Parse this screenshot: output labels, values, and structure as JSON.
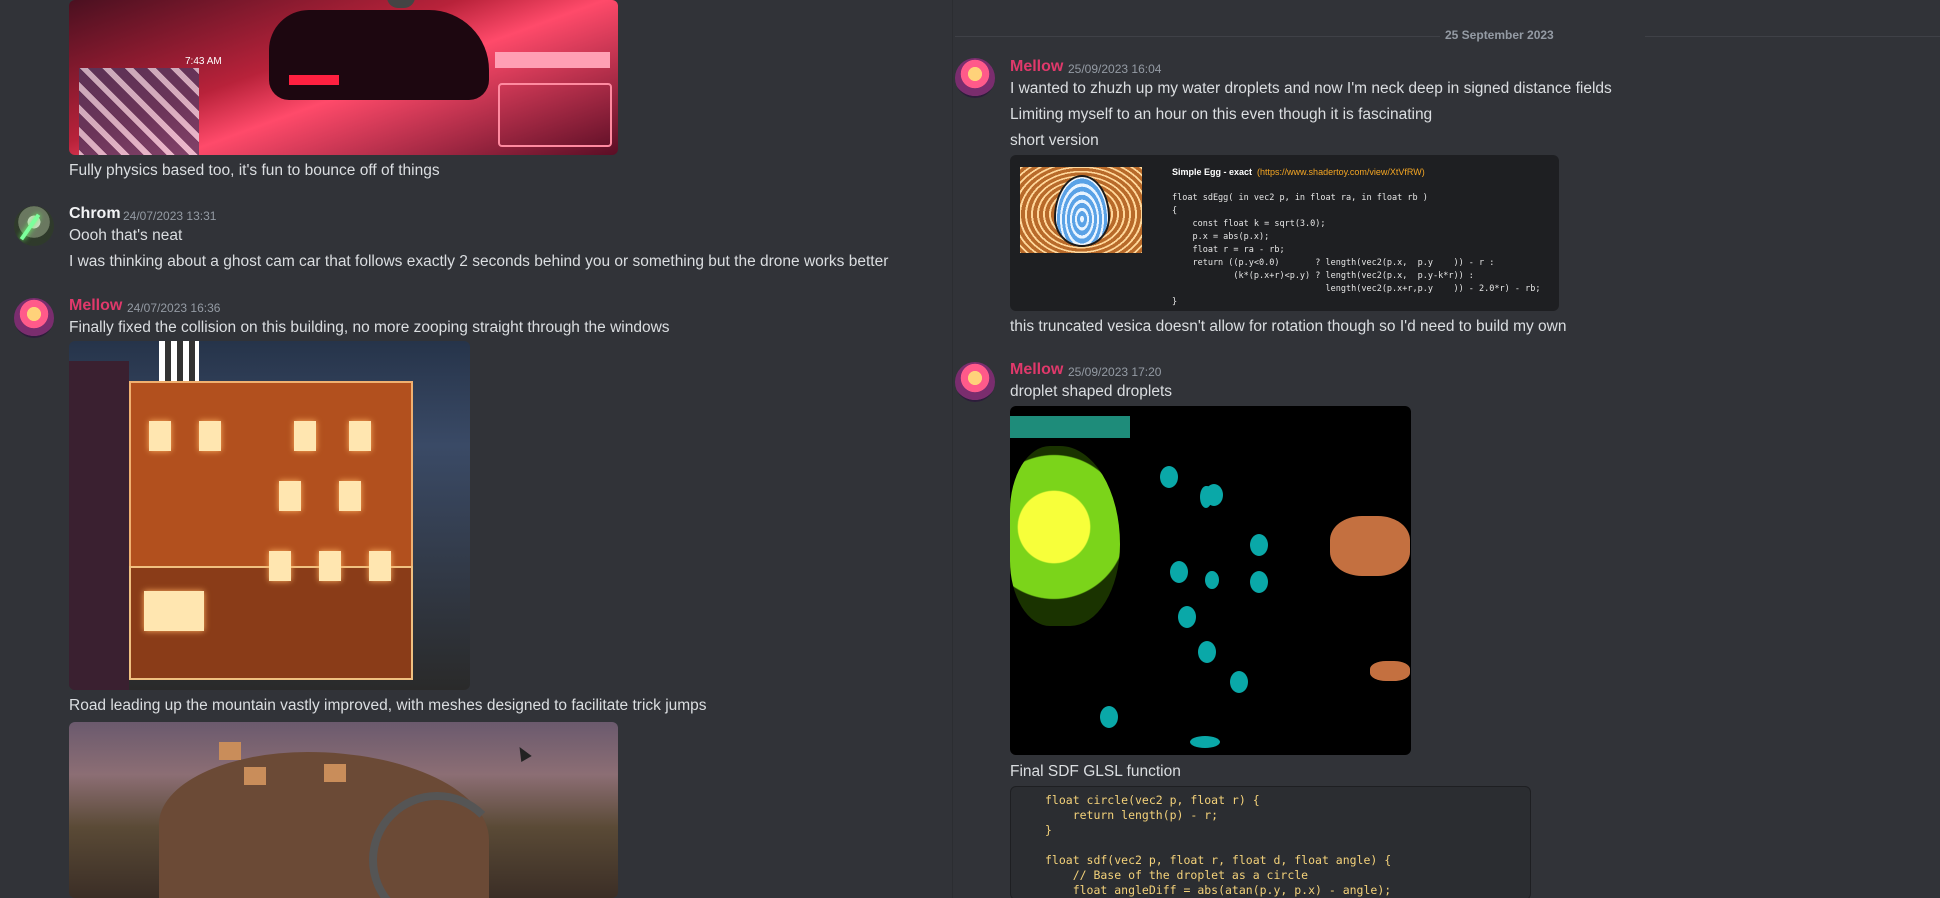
{
  "left": {
    "messages": [
      {
        "type": "continuation",
        "text": "Fully physics based too, it's fun to bounce off of things",
        "image_time": "7:43 AM"
      },
      {
        "author": "Chrom",
        "timestamp": "24/07/2023 13:31",
        "lines": [
          "Oooh that's neat",
          "I was thinking about a ghost cam car that follows exactly 2 seconds behind you or something but the drone works better"
        ]
      },
      {
        "author": "Mellow",
        "timestamp": "24/07/2023 16:36",
        "lines": [
          "Finally fixed the collision on this building, no more zooping straight through the windows",
          "Road leading up the mountain vastly improved, with meshes designed to facilitate trick jumps"
        ]
      }
    ]
  },
  "right": {
    "date_separator": "25 September 2023",
    "messages": [
      {
        "author": "Mellow",
        "timestamp": "25/09/2023 16:04",
        "lines": [
          "I wanted to zhuzh up my water droplets and now I'm neck deep in signed distance fields",
          "Limiting myself to an hour on this even though it is fascinating",
          "short version",
          "this truncated vesica doesn't allow for rotation though so I'd need to build my own"
        ],
        "shader_title": "Simple Egg - exact",
        "shader_url": "(https://www.shadertoy.com/view/XtVfRW)",
        "shader_code": [
          "float sdEgg( in vec2 p, in float ra, in float rb )",
          "{",
          "    const float k = sqrt(3.0);",
          "    p.x = abs(p.x);",
          "    float r = ra - rb;",
          "    return ((p.y<0.0)       ? length(vec2(p.x,  p.y    )) - r :",
          "            (k*(p.x+r)<p.y) ? length(vec2(p.x,  p.y-k*r)) :",
          "                              length(vec2(p.x+r,p.y    )) - 2.0*r) - rb;",
          "}"
        ]
      },
      {
        "author": "Mellow",
        "timestamp": "25/09/2023 17:20",
        "lines": [
          "droplet shaped droplets",
          "Final SDF GLSL function"
        ],
        "code": [
          "float circle(vec2 p, float r) {",
          "    return length(p) - r;",
          "}",
          "",
          "float sdf(vec2 p, float r, float d, float angle) {",
          "    // Base of the droplet as a circle",
          "    float angleDiff = abs(atan(p.y, p.x) - angle);"
        ]
      }
    ]
  },
  "colors": {
    "background": "#313338",
    "username_mellow": "#e0396b",
    "text": "#dbdee1",
    "timestamp": "#949ba4"
  },
  "icons": [
    "play-icon",
    "mouse-cursor-icon"
  ]
}
